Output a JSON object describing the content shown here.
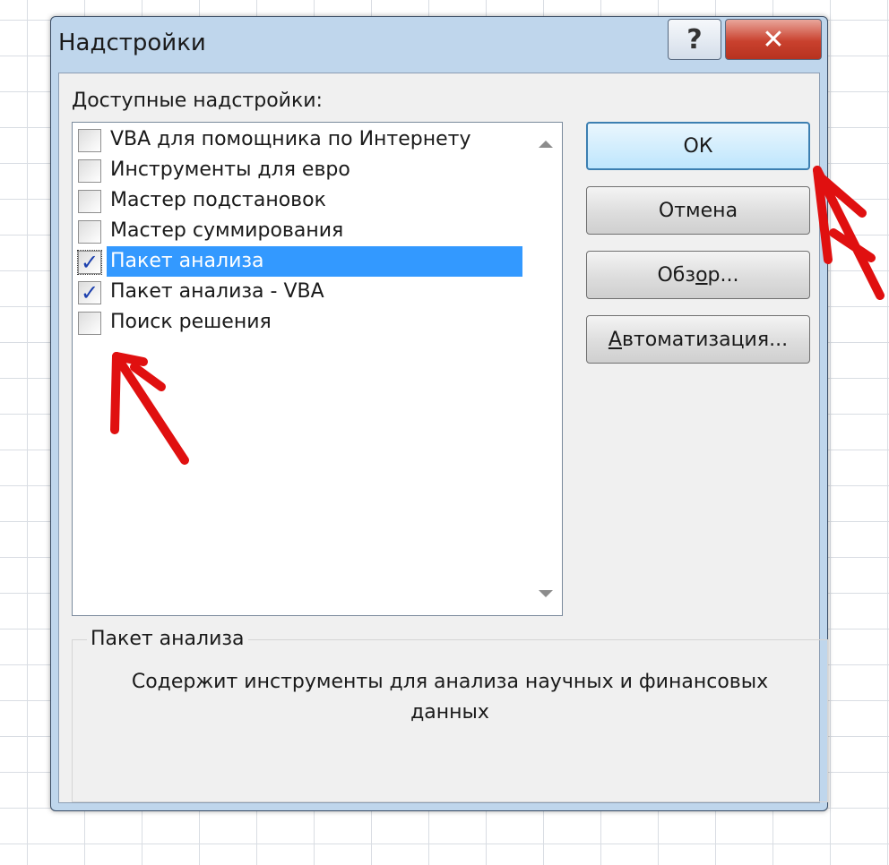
{
  "dialog": {
    "title": "Надстройки",
    "help_glyph": "?",
    "close_glyph": "✕"
  },
  "addins": {
    "label_first": "Д",
    "label_rest": "оступные надстройки:",
    "items": [
      {
        "label": "VBA для помощника по Интернету",
        "checked": false,
        "selected": false
      },
      {
        "label": "Инструменты для евро",
        "checked": false,
        "selected": false
      },
      {
        "label": "Мастер подстановок",
        "checked": false,
        "selected": false
      },
      {
        "label": "Мастер суммирования",
        "checked": false,
        "selected": false
      },
      {
        "label": "Пакет анализа",
        "checked": true,
        "selected": true
      },
      {
        "label": "Пакет анализа - VBA",
        "checked": true,
        "selected": false
      },
      {
        "label": "Поиск решения",
        "checked": false,
        "selected": false
      }
    ]
  },
  "buttons": {
    "ok": "ОК",
    "cancel": "Отмена",
    "browse_a": "Обз",
    "browse_b": "о",
    "browse_c": "р...",
    "automation_a": "А",
    "automation_b": "втоматизация..."
  },
  "description": {
    "title": "Пакет анализа",
    "text": "Содержит инструменты для анализа научных и финансовых данных"
  },
  "colors": {
    "selection": "#3399ff",
    "annotation_arrow": "#e01010"
  },
  "icons": {
    "check": "✓"
  }
}
